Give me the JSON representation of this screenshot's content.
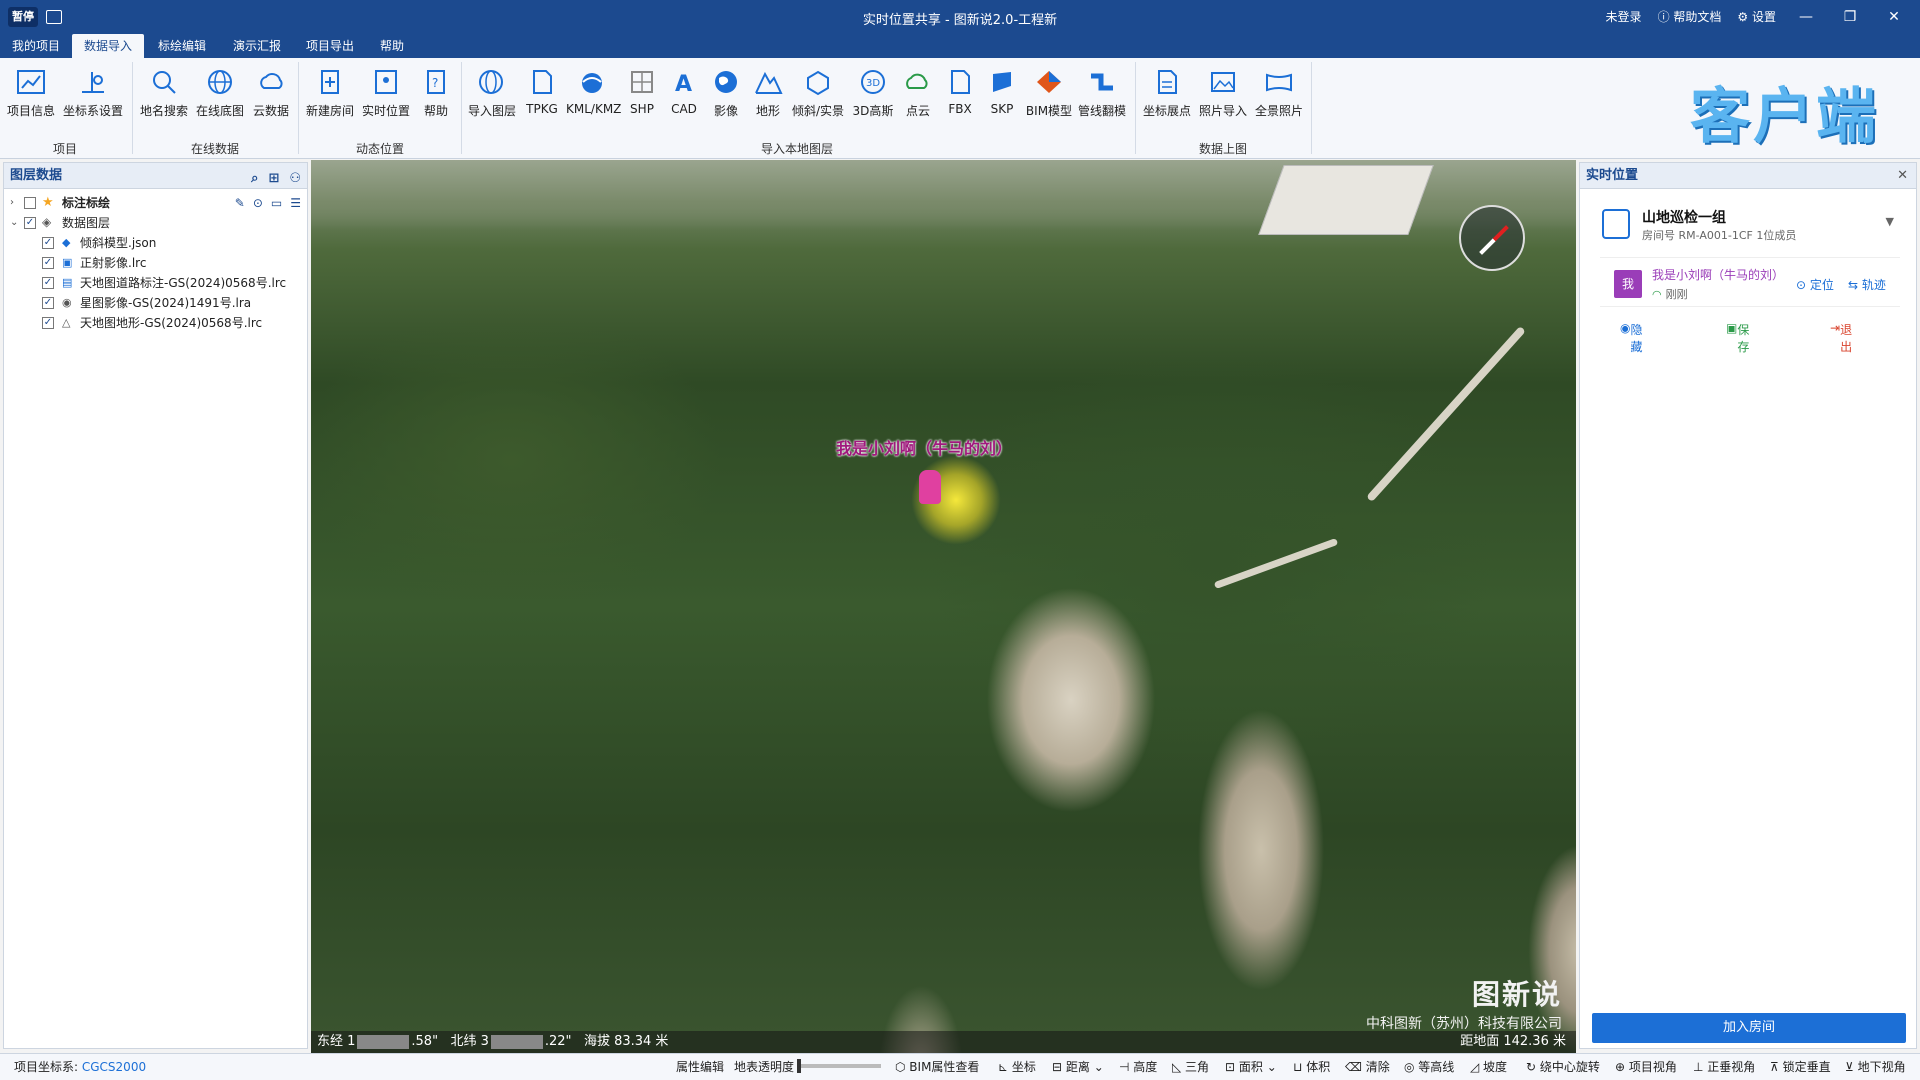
{
  "window": {
    "title": "实时位置共享 - 图新说2.0-工程新",
    "logo_text": "暂停",
    "login": "未登录",
    "help_doc": "帮助文档",
    "settings": "设置"
  },
  "menu_tabs": [
    "我的项目",
    "数据导入",
    "标绘编辑",
    "演示汇报",
    "项目导出",
    "帮助"
  ],
  "ribbon": {
    "groups": [
      {
        "label": "项目",
        "buttons": [
          "项目信息",
          "坐标系设置"
        ]
      },
      {
        "label": "在线数据",
        "buttons": [
          "地名搜索",
          "在线底图",
          "云数据"
        ]
      },
      {
        "label": "动态位置",
        "buttons": [
          "新建房间",
          "实时位置",
          "帮助"
        ]
      },
      {
        "label": "导入本地图层",
        "buttons": [
          "导入图层",
          "TPKG",
          "KML/KMZ",
          "SHP",
          "CAD",
          "影像",
          "地形",
          "倾斜/实景",
          "3D高斯",
          "点云",
          "FBX",
          "SKP",
          "BIM模型",
          "管线翻模"
        ]
      },
      {
        "label": "数据上图",
        "buttons": [
          "坐标展点",
          "照片导入",
          "全景照片"
        ]
      }
    ],
    "brand": "客户端"
  },
  "layer_panel": {
    "title": "图层数据",
    "nodes": [
      {
        "label": "标注标绘",
        "checked": false
      },
      {
        "label": "数据图层",
        "checked": true
      },
      {
        "label": "倾斜模型.json",
        "checked": true
      },
      {
        "label": "正射影像.lrc",
        "checked": true
      },
      {
        "label": "天地图道路标注-GS(2024)0568号.lrc",
        "checked": true
      },
      {
        "label": "星图影像-GS(2024)1491号.lra",
        "checked": true
      },
      {
        "label": "天地图地形-GS(2024)0568号.lrc",
        "checked": true
      }
    ]
  },
  "map": {
    "marker_label": "我是小刘啊（牛马的刘）",
    "watermark_title": "图新说",
    "watermark_company": "中科图新（苏州）科技有限公司",
    "status_lon_prefix": "东经 1",
    "status_lon_suffix": ".58\"",
    "status_lat_prefix": "北纬 3",
    "status_lat_suffix": ".22\"",
    "status_altitude": "海拔 83.34 米",
    "status_distance": "距地面 142.36 米"
  },
  "location_panel": {
    "title": "实时位置",
    "room_name": "山地巡检一组",
    "room_meta": "房间号 RM-A001-1CF  1位成员",
    "member_avatar": "我",
    "member_name": "我是小刘啊（牛马的刘）",
    "member_status": "刚刚",
    "locate": "定位",
    "track": "轨迹",
    "hide": "隐藏",
    "save": "保存",
    "exit": "退出",
    "join": "加入房间"
  },
  "statusbar": {
    "coord_label": "项目坐标系:",
    "coord_value": "CGCS2000",
    "tools": [
      "属性编辑",
      "地表透明度",
      "BIM属性查看",
      "坐标",
      "距离",
      "高度",
      "三角",
      "面积",
      "体积",
      "清除",
      "等高线",
      "坡度",
      "绕中心旋转",
      "项目视角",
      "正垂视角",
      "锁定垂直",
      "地下视角"
    ]
  },
  "colors": {
    "titlebar": "#1c4a8f",
    "accent": "#1c6fd6",
    "member": "#9a3db8",
    "brand": "#5ab4f0"
  }
}
